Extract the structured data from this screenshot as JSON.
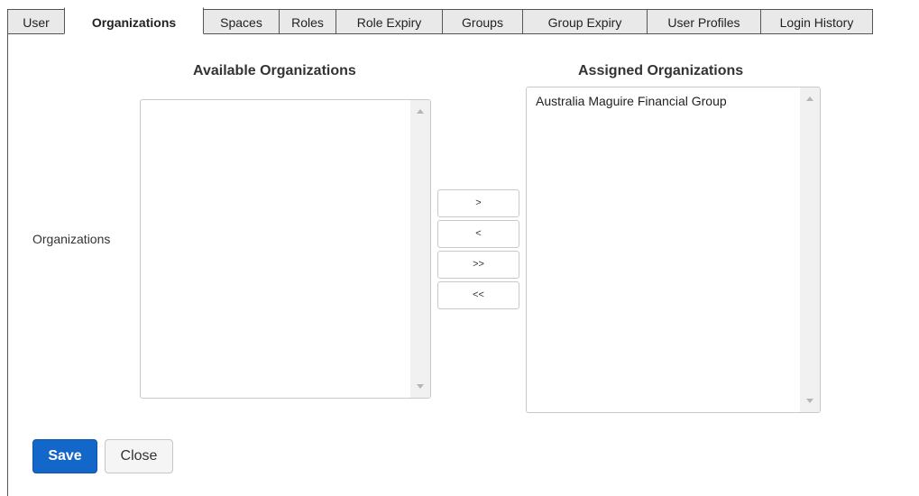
{
  "tabs": [
    {
      "label": "User",
      "active": false
    },
    {
      "label": "Organizations",
      "active": true
    },
    {
      "label": "Spaces",
      "active": false
    },
    {
      "label": "Roles",
      "active": false
    },
    {
      "label": "Role Expiry",
      "active": false
    },
    {
      "label": "Groups",
      "active": false
    },
    {
      "label": "Group Expiry",
      "active": false
    },
    {
      "label": "User Profiles",
      "active": false
    },
    {
      "label": "Login History",
      "active": false
    }
  ],
  "form": {
    "row_label": "Organizations",
    "available": {
      "heading": "Available Organizations",
      "items": []
    },
    "assigned": {
      "heading": "Assigned Organizations",
      "items": [
        "Australia Maguire Financial Group"
      ]
    },
    "move_buttons": {
      "add": ">",
      "remove": "<",
      "add_all": ">>",
      "remove_all": "<<"
    }
  },
  "actions": {
    "save_label": "Save",
    "close_label": "Close"
  },
  "colors": {
    "primary": "#1367c9",
    "tab_inactive": "#e9e9e9",
    "border": "#555555"
  }
}
